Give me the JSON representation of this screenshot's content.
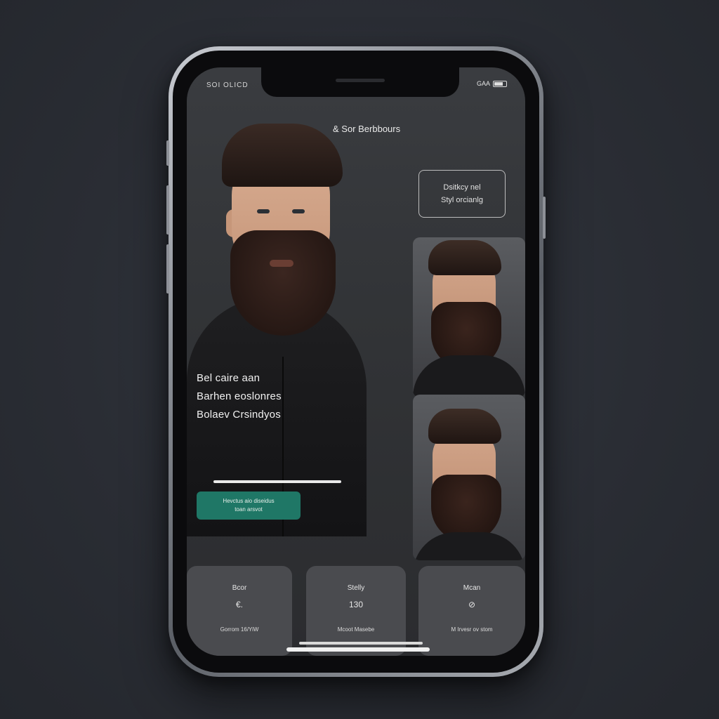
{
  "status": {
    "left_text": "SOI OLICD",
    "right_text": "GAA"
  },
  "header": {
    "brand_title": "& Sor Berbbours"
  },
  "info_box": {
    "line1": "Dsitkcy nel",
    "line2": "Styl orcianlg"
  },
  "hero": {
    "title_lines": [
      "Bel caire aan",
      "Barhen eoslonres",
      "Bolaev Crsindyos"
    ],
    "cta_line1": "Hevctus aio diseidus",
    "cta_line2": "toan arsvot"
  },
  "stats": [
    {
      "label": "Bcor",
      "value": "€.",
      "sub": "Gorrom 16/YiW"
    },
    {
      "label": "Stelly",
      "value": "130",
      "sub": "Mcoot Masebe"
    },
    {
      "label": "Mcan",
      "value": "⊘",
      "sub": "M Irvesr ov stom"
    }
  ],
  "colors": {
    "accent": "#1f7766",
    "background": "#2a2d34",
    "card": "#4a4b4f"
  }
}
